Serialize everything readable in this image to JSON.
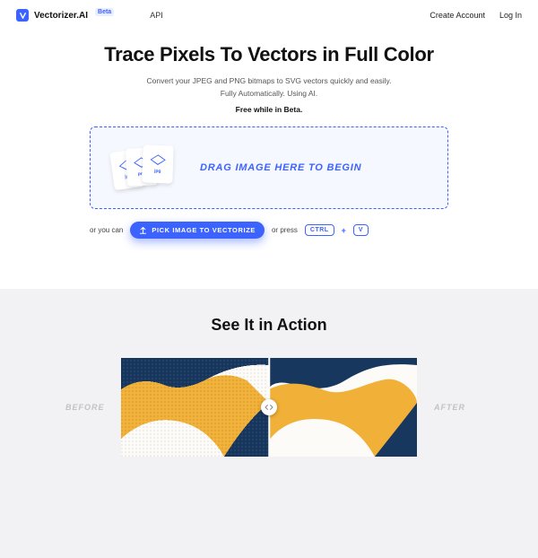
{
  "header": {
    "brand": "Vectorizer.AI",
    "beta": "Beta",
    "nav": {
      "api": "API",
      "create": "Create Account",
      "login": "Log In"
    }
  },
  "hero": {
    "title": "Trace Pixels To Vectors in Full Color",
    "line1": "Convert your JPEG and PNG bitmaps to SVG vectors quickly and easily.",
    "line2": "Fully Automatically. Using AI.",
    "free": "Free while in Beta."
  },
  "dropzone": {
    "label": "DRAG IMAGE HERE TO BEGIN",
    "thumb_exts": [
      "jpg",
      "png",
      "jpg"
    ]
  },
  "below": {
    "prefix": "or you can",
    "button": "PICK IMAGE TO VECTORIZE",
    "mid": "or press",
    "key1": "CTRL",
    "key2": "V"
  },
  "section2": {
    "heading": "See It in Action",
    "before": "BEFORE",
    "after": "AFTER"
  },
  "colors": {
    "accent": "#3c63ff",
    "art_gold": "#f1b037",
    "art_navy": "#17375f",
    "art_bg": "#fcfbf7"
  }
}
